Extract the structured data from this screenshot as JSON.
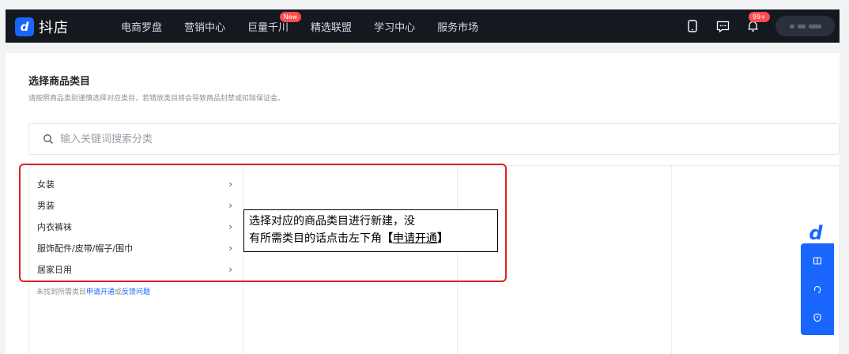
{
  "app": {
    "logo_text": "抖店",
    "logo_glyph": "d"
  },
  "nav": {
    "items": [
      "电商罗盘",
      "营销中心",
      "巨量千川",
      "精选联盟",
      "学习中心",
      "服务市场"
    ],
    "new_badge": "New"
  },
  "header": {
    "bell_badge": "99+"
  },
  "page": {
    "title": "选择商品类目",
    "subtitle": "请按照商品类别谨慎选择对应类目，若错放类目将会导致商品封禁或扣除保证金。",
    "search_placeholder": "输入关键词搜索分类"
  },
  "categories": [
    "女装",
    "男装",
    "内衣裤袜",
    "服饰配件/皮带/帽子/围巾",
    "居家日用"
  ],
  "help": {
    "prefix": "未找到所需类目",
    "apply_link": "申请开通",
    "or": "或",
    "feedback_link": "反馈问题"
  },
  "callout": {
    "line1": "选择对应的商品类目进行新建，没",
    "line2_prefix": "有所需类目的话点击左下角",
    "bracket_open": "【",
    "link": "申请开通",
    "bracket_close": "】"
  },
  "float_icons": [
    "book-icon",
    "headset-icon",
    "shield-icon"
  ],
  "colors": {
    "brand": "#1966ff",
    "topbar": "#14181f",
    "annotation": "#e02020"
  }
}
